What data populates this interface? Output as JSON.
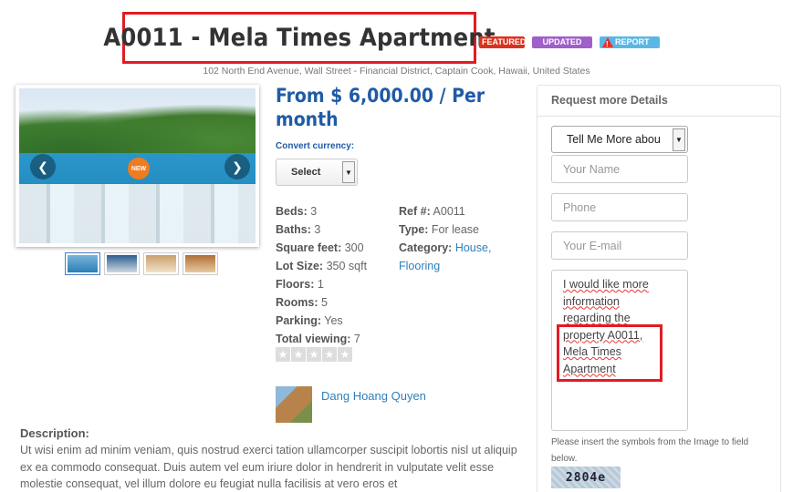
{
  "listing": {
    "title": "A0011 - Mela Times Apartment",
    "badges": {
      "featured": "FEATURED",
      "updated": "UPDATED",
      "report": "REPORT"
    },
    "address": "102 North End Avenue, Wall Street - Financial District, Captain Cook, Hawaii, United States",
    "price": "From $ 6,000.00 / Per month",
    "convert_currency_label": "Convert currency:",
    "currency_select_value": "Select",
    "new_label": "NEW"
  },
  "details_left": [
    {
      "label": "Beds:",
      "value": "3"
    },
    {
      "label": "Baths:",
      "value": "3"
    },
    {
      "label": "Square feet:",
      "value": "300"
    },
    {
      "label": "Lot Size:",
      "value": "350 sqft"
    },
    {
      "label": "Floors:",
      "value": "1"
    },
    {
      "label": "Rooms:",
      "value": "5"
    },
    {
      "label": "Parking:",
      "value": "Yes"
    },
    {
      "label": "Total viewing:",
      "value": "7"
    }
  ],
  "details_right": {
    "ref_label": "Ref #:",
    "ref_value": "A0011",
    "type_label": "Type:",
    "type_value": "For lease",
    "category_label": "Category:",
    "category_house": "House,",
    "category_flooring": "Flooring"
  },
  "rating": {
    "stars": 0,
    "max": 5
  },
  "agent": {
    "name": "Dang Hoang Quyen"
  },
  "description": {
    "label": "Description:",
    "text": "Ut wisi enim ad minim veniam, quis nostrud exerci tation ullamcorper suscipit lobortis nisl ut aliquip ex ea commodo consequat. Duis autem vel eum iriure dolor in hendrerit in vulputate velit esse molestie consequat, vel illum dolore eu feugiat nulla facilisis at vero eros et"
  },
  "request_form": {
    "heading": "Request more Details",
    "inquiry_select_value": "Tell Me More abou",
    "name_placeholder": "Your Name",
    "phone_placeholder": "Phone",
    "email_placeholder": "Your E-mail",
    "message_lines": [
      "I would like more",
      "information",
      "regarding the",
      "property A0011,",
      "Mela Times",
      "Apartment"
    ],
    "captcha_note": "Please insert the symbols from the Image to field below.",
    "captcha_text": "2804e"
  }
}
